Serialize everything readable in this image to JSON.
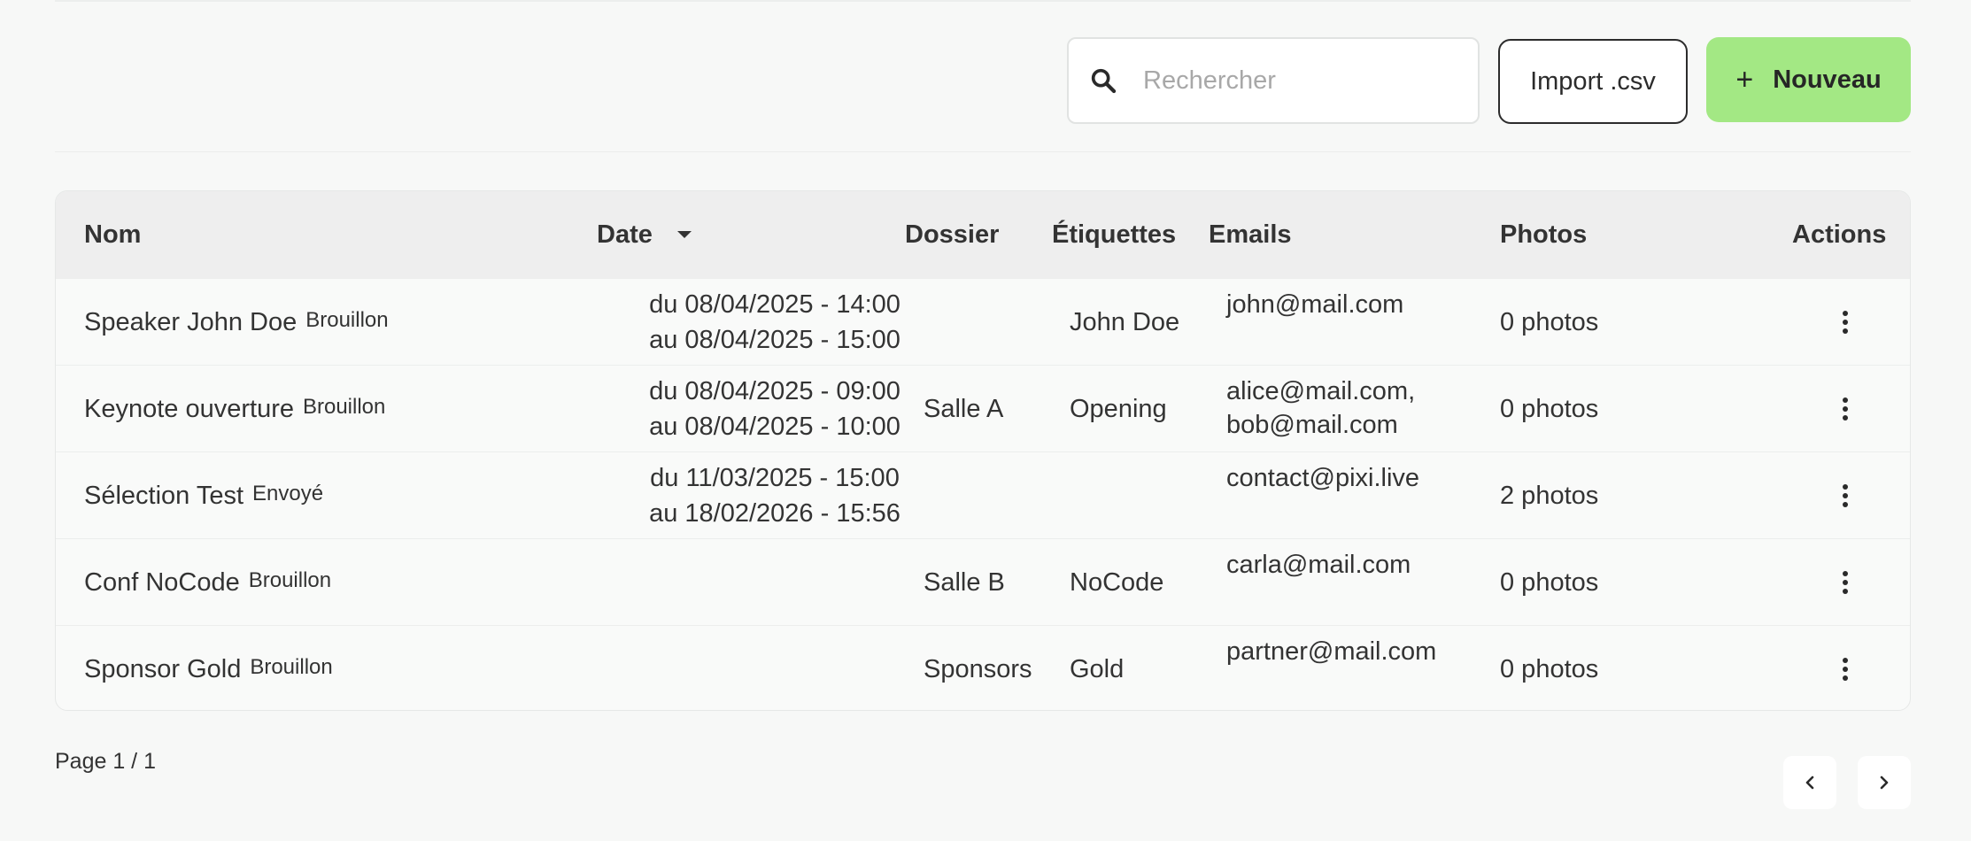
{
  "toolbar": {
    "search_placeholder": "Rechercher",
    "import_label": "Import .csv",
    "new_plus": "+",
    "new_label": "Nouveau"
  },
  "table": {
    "headers": {
      "name": "Nom",
      "date": "Date",
      "dossier": "Dossier",
      "tags": "Étiquettes",
      "emails": "Emails",
      "photos": "Photos",
      "actions": "Actions"
    },
    "rows": [
      {
        "name": "Speaker John Doe",
        "status": "Brouillon",
        "date_from": "du 08/04/2025 - 14:00",
        "date_to": "au 08/04/2025 - 15:00",
        "dossier": "",
        "tags": "John Doe",
        "email1": "john@mail.com",
        "email2": "",
        "photos": "0 photos"
      },
      {
        "name": "Keynote ouverture",
        "status": "Brouillon",
        "date_from": "du 08/04/2025 - 09:00",
        "date_to": "au 08/04/2025 - 10:00",
        "dossier": "Salle A",
        "tags": "Opening",
        "email1": "alice@mail.com,",
        "email2": "bob@mail.com",
        "photos": "0 photos"
      },
      {
        "name": "Sélection Test",
        "status": "Envoyé",
        "date_from": "du 11/03/2025 - 15:00",
        "date_to": "au 18/02/2026 - 15:56",
        "dossier": "",
        "tags": "",
        "email1": "contact@pixi.live",
        "email2": "",
        "photos": "2 photos"
      },
      {
        "name": "Conf NoCode",
        "status": "Brouillon",
        "date_from": "",
        "date_to": "",
        "dossier": "Salle B",
        "tags": "NoCode",
        "email1": "carla@mail.com",
        "email2": "",
        "photos": "0 photos"
      },
      {
        "name": "Sponsor Gold",
        "status": "Brouillon",
        "date_from": "",
        "date_to": "",
        "dossier": "Sponsors",
        "tags": "Gold",
        "email1": "partner@mail.com",
        "email2": "",
        "photos": "0 photos"
      }
    ]
  },
  "pagination": {
    "label": "Page 1 / 1"
  },
  "colors": {
    "accent": "#a3e884",
    "header_bg": "#eeeeee",
    "page_bg": "#f7f8f7"
  },
  "icons": {
    "search": "search-icon",
    "sort": "caret-down-icon",
    "actions": "more-vertical-icon",
    "prev": "chevron-left-icon",
    "next": "chevron-right-icon"
  }
}
